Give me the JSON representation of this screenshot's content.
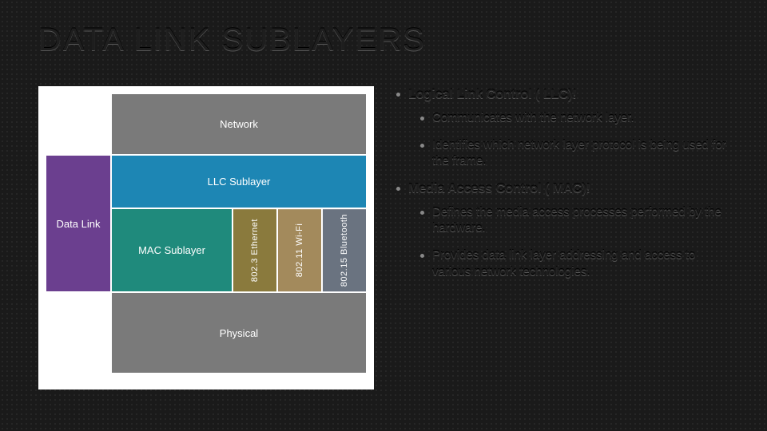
{
  "title": "DATA LINK SUBLAYERS",
  "diagram": {
    "network": "Network",
    "datalink": "Data Link",
    "physical": "Physical",
    "llc": "LLC Sublayer",
    "mac": "MAC Sublayer",
    "protocols": [
      "802.3 Ethernet",
      "802.11 Wi-Fi",
      "802.15 Bluetooth"
    ]
  },
  "bullets": {
    "llc_title": "Logical  Link Control (  LLC)!",
    "llc_items": [
      "Communicates with the network layer.",
      "Identifies which network layer protocol is being used for the frame."
    ],
    "mac_title": "Media Access Control (  MAC)!",
    "mac_items": [
      "Defines the media access processes performed by the hardware.",
      "Provides data link layer addressing and access to various network technologies."
    ]
  }
}
